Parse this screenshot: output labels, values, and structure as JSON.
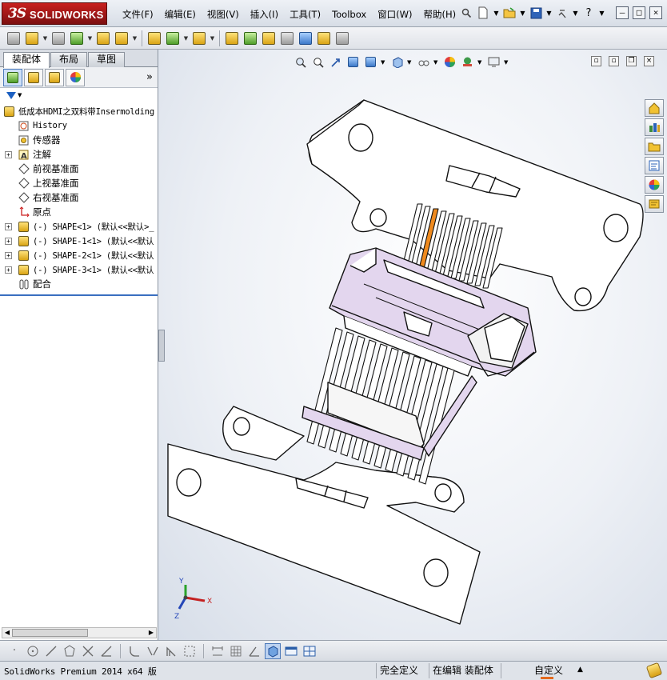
{
  "app": {
    "logo_ds": "3S",
    "logo_text": "SOLIDWORKS"
  },
  "menu": [
    "文件(F)",
    "编辑(E)",
    "视图(V)",
    "插入(I)",
    "工具(T)",
    "Toolbox",
    "窗口(W)",
    "帮助(H)"
  ],
  "top_icons": [
    "pin-icon",
    "new-document-icon",
    "open-folder-icon",
    "save-icon",
    "print-icon",
    "help-icon"
  ],
  "window_buttons": [
    "minimize",
    "restore",
    "close"
  ],
  "panel_tabs": [
    "装配体",
    "布局",
    "草图"
  ],
  "panel_icons": [
    "featuremanager-icon",
    "propertymanager-icon",
    "configurationmanager-icon",
    "display-manager-icon"
  ],
  "tree": [
    {
      "label": "低成本HDMI之双料带Insermolding",
      "level": 0,
      "icon": "assembly-icon",
      "expander": ""
    },
    {
      "label": "History",
      "level": 1,
      "icon": "history-icon",
      "expander": ""
    },
    {
      "label": "传感器",
      "level": 1,
      "icon": "sensor-icon",
      "expander": ""
    },
    {
      "label": "注解",
      "level": 1,
      "icon": "annotation-icon",
      "expander": "+"
    },
    {
      "label": "前视基准面",
      "level": 1,
      "icon": "plane-icon",
      "expander": ""
    },
    {
      "label": "上视基准面",
      "level": 1,
      "icon": "plane-icon",
      "expander": ""
    },
    {
      "label": "右视基准面",
      "level": 1,
      "icon": "plane-icon",
      "expander": ""
    },
    {
      "label": "原点",
      "level": 1,
      "icon": "origin-icon",
      "expander": ""
    },
    {
      "label": "(-) SHAPE<1> (默认<<默认>_",
      "level": 1,
      "icon": "part-icon",
      "expander": "+"
    },
    {
      "label": "(-) SHAPE-1<1> (默认<<默认",
      "level": 1,
      "icon": "part-icon",
      "expander": "+"
    },
    {
      "label": "(-) SHAPE-2<1> (默认<<默认",
      "level": 1,
      "icon": "part-icon",
      "expander": "+"
    },
    {
      "label": "(-) SHAPE-3<1> (默认<<默认",
      "level": 1,
      "icon": "part-icon",
      "expander": "+"
    },
    {
      "label": "配合",
      "level": 1,
      "icon": "mates-icon",
      "expander": ""
    }
  ],
  "triad": {
    "x": "X",
    "y": "Y",
    "z": "Z"
  },
  "status": {
    "product": "SolidWorks Premium 2014 x64 版",
    "definition": "完全定义",
    "editing": "在编辑 装配体",
    "units": "自定义",
    "units_arrow": "▲"
  },
  "colors": {
    "accent_blue": "#3a6fc0",
    "logo_red": "#c8201f",
    "part_purple": "#e3d6ee",
    "highlight_orange": "#ef8a1e"
  }
}
